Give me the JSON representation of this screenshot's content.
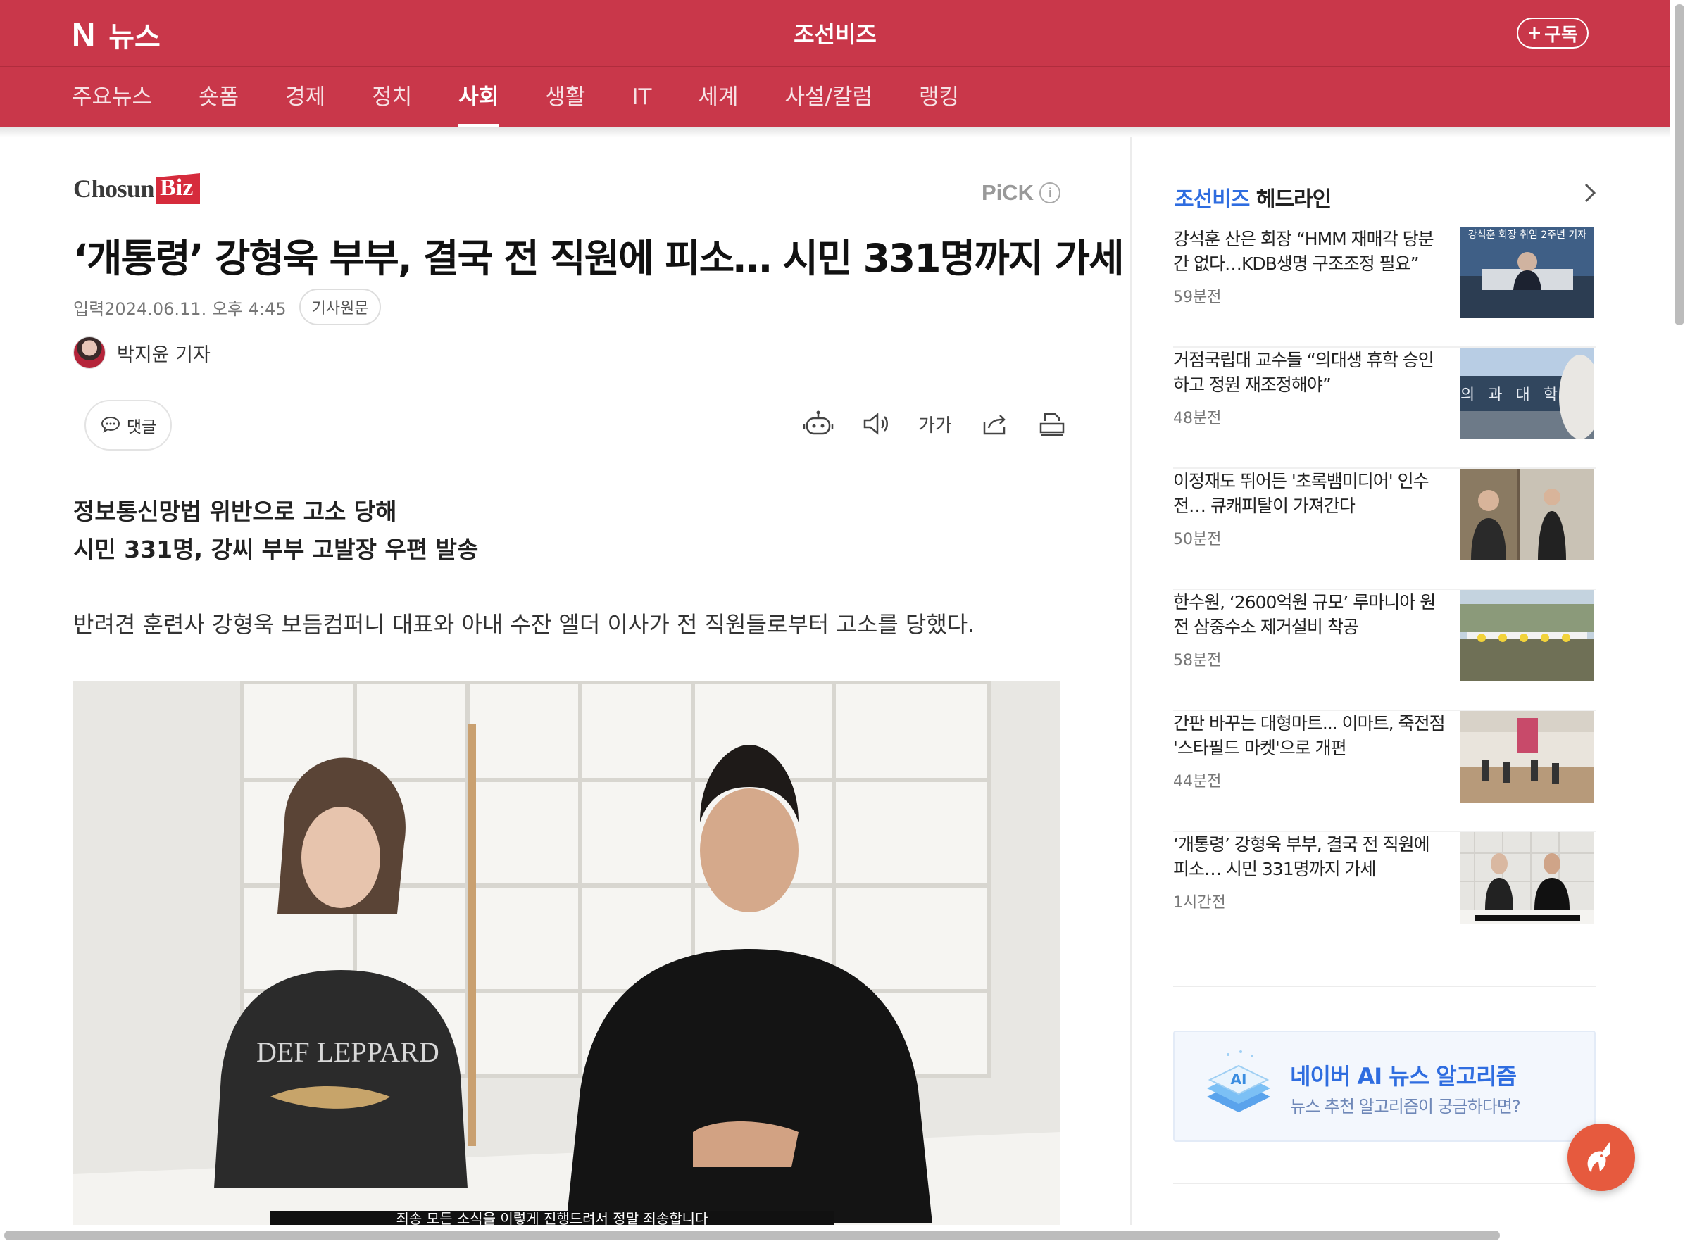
{
  "header": {
    "brand_n": "N",
    "brand_text": "뉴스",
    "press": "조선비즈",
    "subscribe": "구독"
  },
  "nav": {
    "items": [
      {
        "label": "주요뉴스"
      },
      {
        "label": "숏폼"
      },
      {
        "label": "경제"
      },
      {
        "label": "정치"
      },
      {
        "label": "사회"
      },
      {
        "label": "생활"
      },
      {
        "label": "IT"
      },
      {
        "label": "세계"
      },
      {
        "label": "사설/칼럼"
      },
      {
        "label": "랭킹"
      }
    ],
    "active": "사회"
  },
  "article": {
    "logo_chosun": "Chosun",
    "logo_biz": "Biz",
    "pick": "PiCK",
    "pick_info": "i",
    "headline": "‘개통령’ 강형욱 부부, 결국 전 직원에 피소… 시민 331명까지 가세",
    "date": "입력2024.06.11. 오후 4:45",
    "original_link": "기사원문",
    "reporter": "박지윤 기자",
    "comment": "댓글",
    "font_size_label": "가가",
    "subhead1": "정보통신망법 위반으로 고소 당해",
    "subhead2": "시민 331명, 강씨 부부 고발장 우편 발송",
    "lede": "반려견 훈련사 강형욱 보듬컴퍼니 대표와 아내 수잔 엘더 이사가 전 직원들로부터 고소를 당했다.",
    "photo_shirt_text": "DEF LEPPARD",
    "photo_caption": "죄송 모든 소식을 이렇게 진행드려서 정말 죄송합니다"
  },
  "sidebar": {
    "press": "조선비즈",
    "title": "헤드라인",
    "headlines": [
      {
        "title": "강석훈 산은 회장 “HMM 재매각 당분간 없다…KDB생명 구조조정 필요”",
        "time": "59분전",
        "thumb_text": "강석훈 회장 취임 2주년 기자"
      },
      {
        "title": "거점국립대 교수들 “의대생 휴학 승인하고 정원 재조정해야”",
        "time": "48분전",
        "thumb_text": "의 과 대 학"
      },
      {
        "title": "이정재도 뛰어든 '초록뱀미디어' 인수전… 큐캐피탈이 가져간다",
        "time": "50분전",
        "thumb_text": ""
      },
      {
        "title": "한수원, ‘2600억원 규모’ 루마니아 원전 삼중수소 제거설비 착공",
        "time": "58분전",
        "thumb_text": ""
      },
      {
        "title": "간판 바꾸는 대형마트... 이마트, 죽전점 '스타필드 마켓'으로 개편",
        "time": "44분전",
        "thumb_text": ""
      },
      {
        "title": "‘개통령’ 강형욱 부부, 결국 전 직원에 피소… 시민 331명까지 가세",
        "time": "1시간전",
        "thumb_text": ""
      }
    ],
    "ai_title": "네이버 AI 뉴스 알고리즘",
    "ai_subtitle": "뉴스 추천 알고리즘이 궁금하다면?",
    "ai_badge": "AI"
  },
  "colors": {
    "brand": "#c9374a",
    "accent_blue": "#2f6de0",
    "fab": "#e65a3e"
  }
}
